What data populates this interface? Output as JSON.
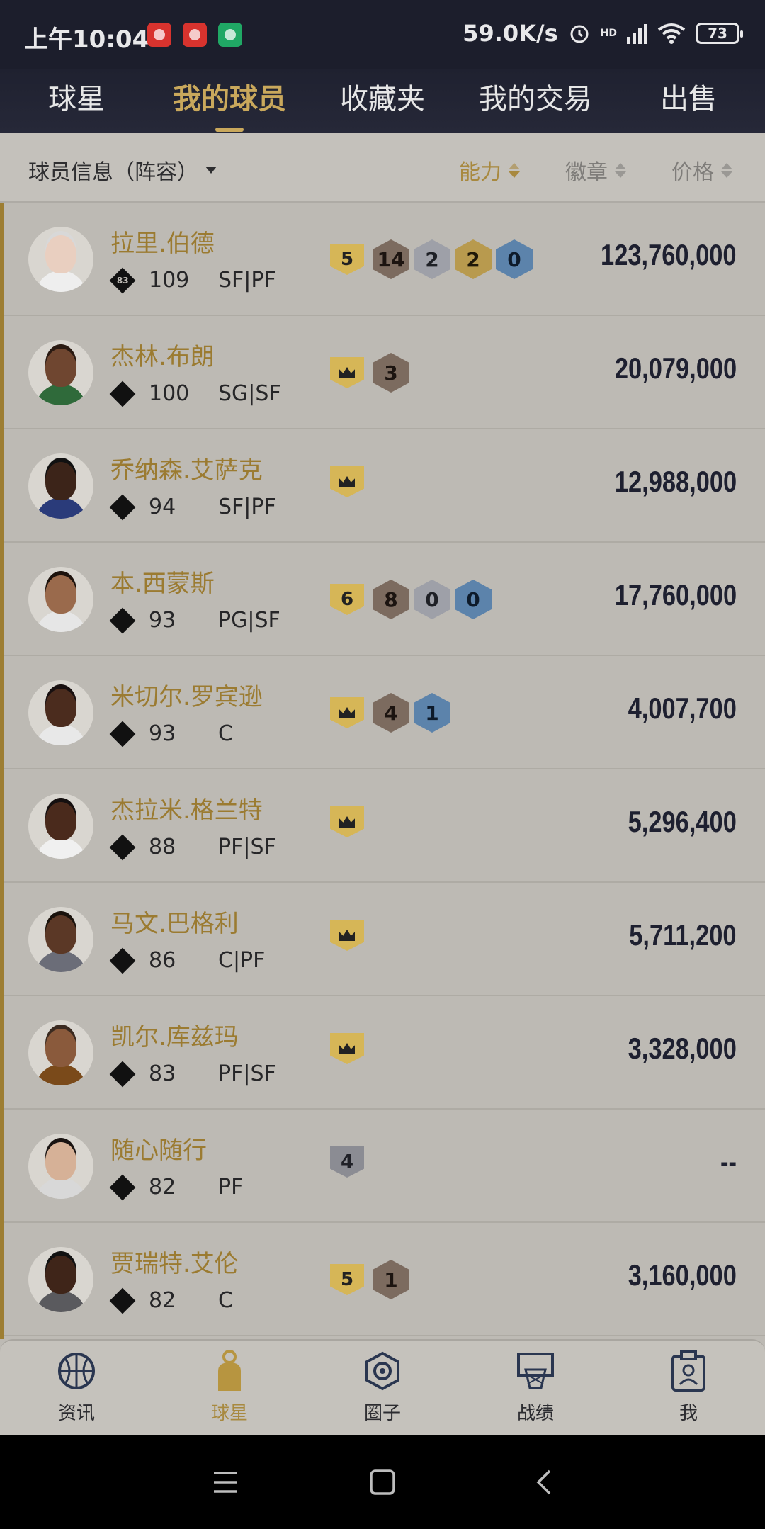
{
  "status_bar": {
    "time": "上午10:04",
    "net_speed": "59.0K/s",
    "battery": "73",
    "hd_label": "HD"
  },
  "top_tabs": [
    {
      "label": "球星",
      "active": false
    },
    {
      "label": "我的球员",
      "active": true
    },
    {
      "label": "收藏夹",
      "active": false
    },
    {
      "label": "我的交易",
      "active": false
    },
    {
      "label": "出售",
      "active": false
    }
  ],
  "sort_bar": {
    "info_label": "球员信息（阵容）",
    "ability_label": "能力",
    "badge_label": "徽章",
    "price_label": "价格"
  },
  "players": [
    {
      "name": "拉里.伯德",
      "rating_icon_num": "83",
      "ovr": "109",
      "pos": "SF|PF",
      "tier": "5",
      "tier_color": "gold",
      "badges": [
        {
          "v": "14",
          "c": "bronze"
        },
        {
          "v": "2",
          "c": "silver"
        },
        {
          "v": "2",
          "c": "gold"
        },
        {
          "v": "0",
          "c": "blue"
        }
      ],
      "price": "123,760,000",
      "skin": "#e9cfc0",
      "hair": "#d8d8d8",
      "jersey": "#eeeeee"
    },
    {
      "name": "杰林.布朗",
      "rating_icon_num": "",
      "ovr": "100",
      "pos": "SG|SF",
      "tier": "crown",
      "tier_color": "gold",
      "badges": [
        {
          "v": "3",
          "c": "bronze"
        }
      ],
      "price": "20,079,000",
      "skin": "#6f4630",
      "hair": "#2a1a12",
      "jersey": "#2f6a3a"
    },
    {
      "name": "乔纳森.艾萨克",
      "rating_icon_num": "",
      "ovr": "94",
      "pos": "SF|PF",
      "tier": "crown",
      "tier_color": "gold",
      "badges": [],
      "price": "12,988,000",
      "skin": "#3c2419",
      "hair": "#111111",
      "jersey": "#2a3b7a"
    },
    {
      "name": "本.西蒙斯",
      "rating_icon_num": "",
      "ovr": "93",
      "pos": "PG|SF",
      "tier": "6",
      "tier_color": "gold",
      "badges": [
        {
          "v": "8",
          "c": "bronze"
        },
        {
          "v": "0",
          "c": "silver"
        },
        {
          "v": "0",
          "c": "blue"
        }
      ],
      "price": "17,760,000",
      "skin": "#9a6a4c",
      "hair": "#1d120c",
      "jersey": "#e6e6e6"
    },
    {
      "name": "米切尔.罗宾逊",
      "rating_icon_num": "",
      "ovr": "93",
      "pos": "C",
      "tier": "crown",
      "tier_color": "gold",
      "badges": [
        {
          "v": "4",
          "c": "bronze"
        },
        {
          "v": "1",
          "c": "blue"
        }
      ],
      "price": "4,007,700",
      "skin": "#4b2c1e",
      "hair": "#181010",
      "jersey": "#e8e8e8"
    },
    {
      "name": "杰拉米.格兰特",
      "rating_icon_num": "",
      "ovr": "88",
      "pos": "PF|SF",
      "tier": "crown",
      "tier_color": "gold",
      "badges": [],
      "price": "5,296,400",
      "skin": "#4a2a1c",
      "hair": "#151010",
      "jersey": "#f0f0f0"
    },
    {
      "name": "马文.巴格利",
      "rating_icon_num": "",
      "ovr": "86",
      "pos": "C|PF",
      "tier": "crown",
      "tier_color": "gold",
      "badges": [],
      "price": "5,711,200",
      "skin": "#5b3826",
      "hair": "#1a120c",
      "jersey": "#6b6d78"
    },
    {
      "name": "凯尔.库兹玛",
      "rating_icon_num": "",
      "ovr": "83",
      "pos": "PF|SF",
      "tier": "crown",
      "tier_color": "gold",
      "badges": [],
      "price": "3,328,000",
      "skin": "#8a5a3c",
      "hair": "#3a2a20",
      "jersey": "#7a4a1a"
    },
    {
      "name": "随心随行",
      "rating_icon_num": "",
      "ovr": "82",
      "pos": "PF",
      "tier": "4",
      "tier_color": "grey",
      "badges": [],
      "price": "--",
      "skin": "#d6b197",
      "hair": "#1a1412",
      "jersey": "#d8d8d8"
    },
    {
      "name": "贾瑞特.艾伦",
      "rating_icon_num": "",
      "ovr": "82",
      "pos": "C",
      "tier": "5",
      "tier_color": "gold",
      "badges": [
        {
          "v": "1",
          "c": "bronze"
        }
      ],
      "price": "3,160,000",
      "skin": "#3f2519",
      "hair": "#111111",
      "jersey": "#5a5a5e"
    }
  ],
  "bottom_nav": [
    {
      "label": "资讯",
      "icon": "basketball-icon",
      "active": false
    },
    {
      "label": "球星",
      "icon": "player-icon",
      "active": true
    },
    {
      "label": "圈子",
      "icon": "circle-icon",
      "active": false
    },
    {
      "label": "战绩",
      "icon": "hoop-icon",
      "active": false
    },
    {
      "label": "我",
      "icon": "profile-icon",
      "active": false
    }
  ],
  "colors": {
    "accent_gold": "#c9a85c",
    "header_bg": "#1f2130",
    "list_bg": "#bdbab4"
  }
}
